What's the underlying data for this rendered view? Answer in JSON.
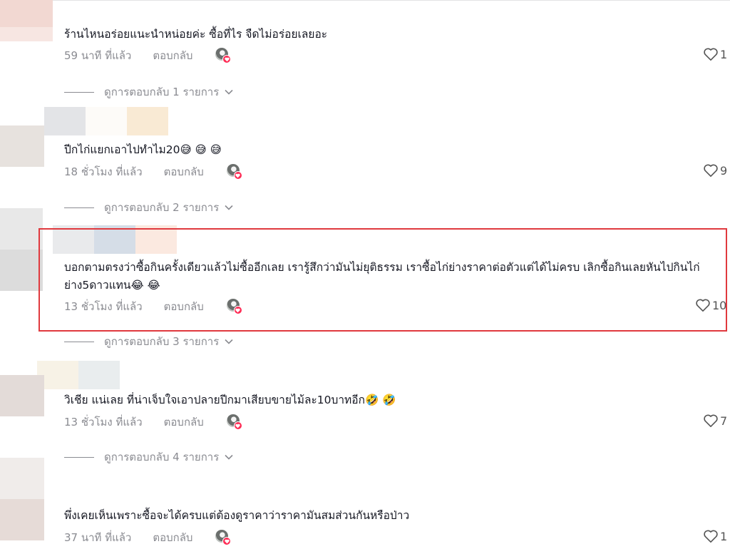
{
  "comments": [
    {
      "text": "ร้านไหนอร่อยแนะนำหน่อยค่ะ ซื้อที่ไร จืดไม่อร่อยเลยอะ",
      "time": "59 นาที ที่แล้ว",
      "reply": "ตอบกลับ",
      "likes": "1",
      "view_replies": "ดูการตอบกลับ 1 รายการ"
    },
    {
      "text": "ปีกไก่แยกเอาไปทำไม20😅 😅 😅",
      "time": "18 ชั่วโมง ที่แล้ว",
      "reply": "ตอบกลับ",
      "likes": "9",
      "view_replies": "ดูการตอบกลับ 2 รายการ"
    },
    {
      "text": "บอกตามตรงว่าซื้อกินครั้งเดียวแล้วไม่ซื้ออีกเลย เรารู้สึกว่ามันไม่ยุติธรรม เราซื้อไก่ย่างราคาต่อตัวแต่ได้ไม่ครบ เลิกซื้อกินเลยหันไปกินไก่ย่าง5ดาวแทน😂 😂",
      "time": "13 ชั่วโมง ที่แล้ว",
      "reply": "ตอบกลับ",
      "likes": "10",
      "view_replies": "ดูการตอบกลับ 3 รายการ"
    },
    {
      "text": "วิเชีย แน่เลย ที่น่าเจ็บใจเอาปลายปีกมาเสียบขายไม้ละ10บาทอีก🤣 🤣",
      "time": "13 ชั่วโมง ที่แล้ว",
      "reply": "ตอบกลับ",
      "likes": "7",
      "view_replies": "ดูการตอบกลับ 4 รายการ"
    },
    {
      "text": "พึ่งเคยเห็นเพราะซื้อจะได้ครบแต่ต้องดูราคาว่าราคามันสมส่วนกันหรือป่าว",
      "time": "37 นาที ที่แล้ว",
      "reply": "ตอบกลับ",
      "likes": "1"
    }
  ],
  "colors": {
    "highlight_border": "#e0393e",
    "creator_badge": "#fe2c55",
    "meta_text": "#8a8b91"
  },
  "icons": {
    "like": "heart-outline-icon",
    "expand": "chevron-down-icon",
    "creator": "creator-avatar-heart-icon"
  }
}
